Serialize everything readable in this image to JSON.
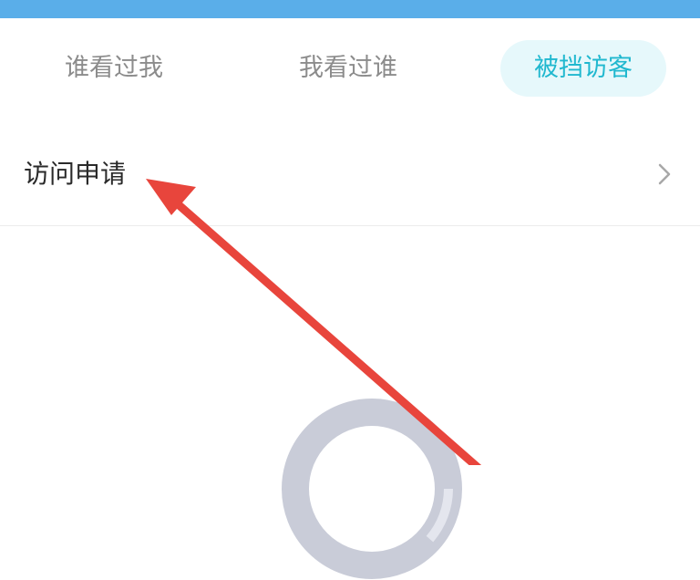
{
  "tabs": [
    {
      "label": "谁看过我",
      "active": false
    },
    {
      "label": "我看过谁",
      "active": false
    },
    {
      "label": "被挡访客",
      "active": true
    }
  ],
  "list": {
    "items": [
      {
        "label": "访问申请",
        "icon": "chevron-right-icon"
      }
    ]
  },
  "empty_state": {
    "icon": "empty-state-illustration"
  },
  "annotation": {
    "icon": "red-arrow-icon",
    "color": "#e8453c"
  },
  "colors": {
    "header": "#5aaee9",
    "active_tab_text": "#20b8cf",
    "active_tab_bg": "#e6f8fb",
    "inactive_tab_text": "#8c8c8c"
  }
}
